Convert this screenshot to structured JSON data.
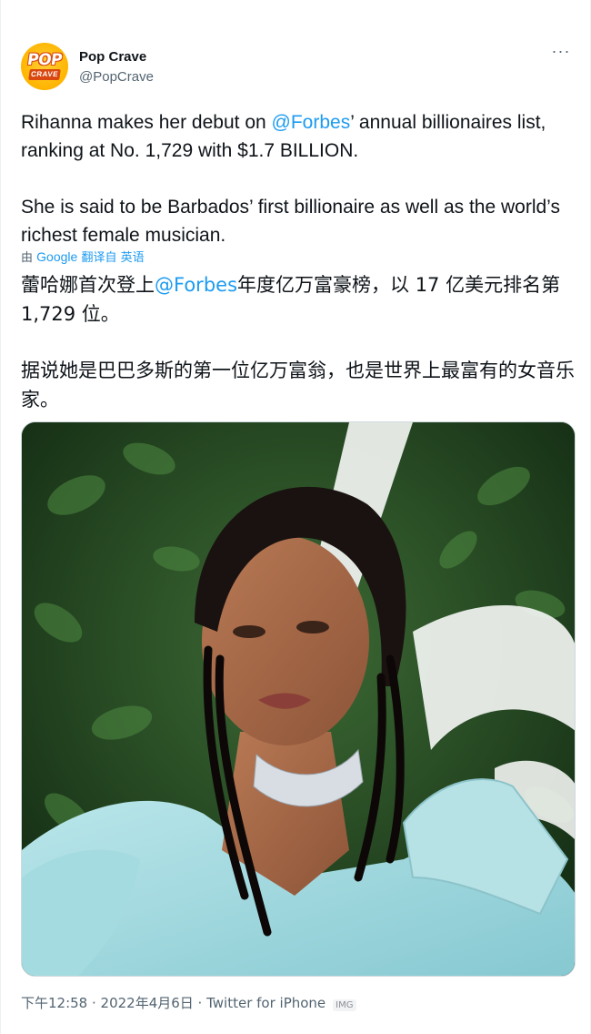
{
  "account": {
    "display_name": "Pop Crave",
    "handle": "@PopCrave",
    "avatar_text_top": "POP",
    "avatar_text_bottom": "CRAVE",
    "more_icon": "more-horizontal-icon"
  },
  "tweet": {
    "en_line1_pre": "Rihanna makes her debut on ",
    "en_mention": "@Forbes",
    "en_line1_post": "’ annual billionaires list, ranking at No. 1,729 with $1.7 BILLION.",
    "en_paragraph2": "She is said to be Barbados’ first billionaire as well as the world’s richest female musician."
  },
  "translation": {
    "by": "由",
    "provider": "Google",
    "action": "翻译自 英语",
    "zh_pre": "蕾哈娜首次登上",
    "zh_mention": "@Forbes",
    "zh_post": "年度亿万富豪榜，以 17 亿美元排名第 1,729 位。",
    "zh_paragraph2": "据说她是巴巴多斯的第一位亿万富翁，也是世界上最富有的女音乐家。"
  },
  "footer": {
    "meta": "下午12:58 · 2022年4月6日 · Twitter for iPhone",
    "badge": "IMG"
  },
  "colors": {
    "link": "#1d9bf0",
    "secondary_text": "#536471",
    "primary_text": "#0f1419"
  }
}
